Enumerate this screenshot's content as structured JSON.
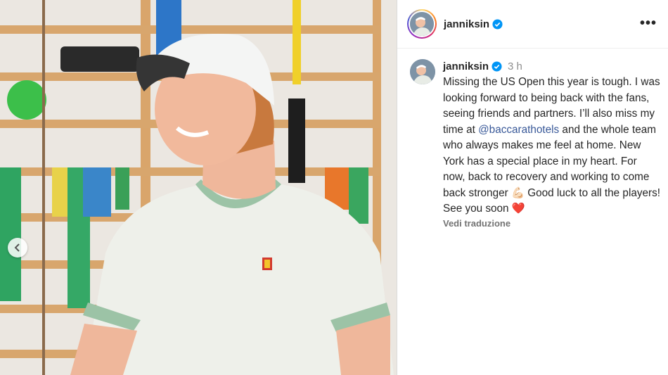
{
  "post": {
    "username": "janniksin",
    "time": "3 h",
    "caption_parts": {
      "p1": "Missing the US Open this year is tough. I was looking forward to being back with the fans, seeing friends and partners. I’ll also miss my time at ",
      "mention": "@baccarathotels",
      "p2": " and the whole team who always makes me feel at home. New York has a special place in my heart. For now, back to recovery and working to come back stronger ",
      "emoji1": "💪🏻",
      "p3": " Good luck to all the players! See you soon ",
      "emoji2": "❤️"
    },
    "see_translation": "Vedi traduzione"
  },
  "icons": {
    "verified": "verified-badge-icon",
    "more": "more-options-icon",
    "prev": "chevron-left-icon"
  },
  "colors": {
    "verified_blue": "#0095f6",
    "mention": "#385898",
    "meta_grey": "#8e8e8e"
  }
}
